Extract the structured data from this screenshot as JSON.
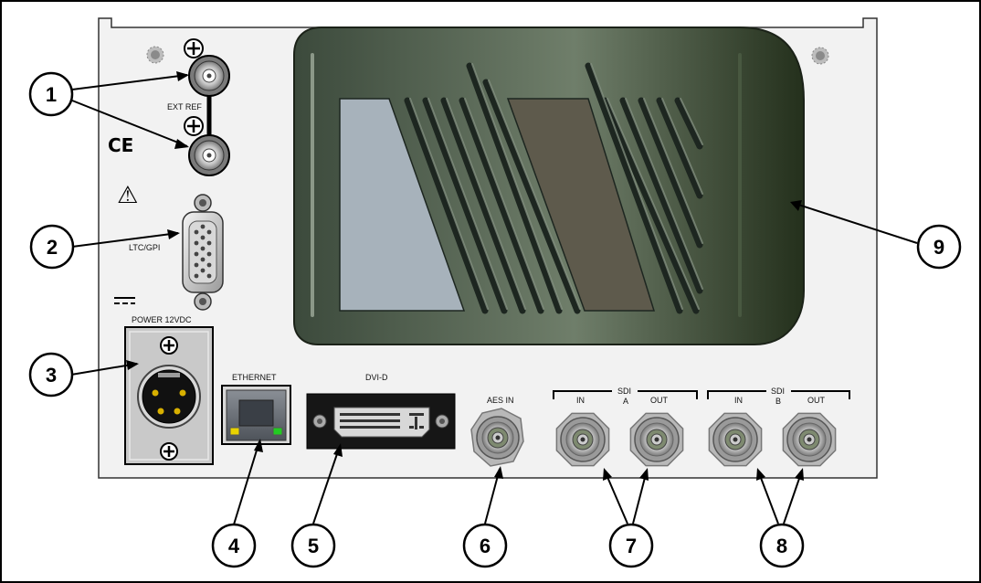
{
  "labels": {
    "ext_ref": "EXT REF",
    "ltc_gpi": "LTC/GPI",
    "power": "POWER 12VDC",
    "ethernet": "ETHERNET",
    "dvi_d": "DVI-D",
    "aes_in": "AES IN",
    "sdi_a": "SDI",
    "sdi_a_sub": "A",
    "sdi_b": "SDI",
    "sdi_b_sub": "B",
    "in_a": "IN",
    "out_a": "OUT",
    "in_b": "IN",
    "out_b": "OUT",
    "ce_mark": "CE",
    "warning_symbol": "⚠",
    "dc_symbol": "⎓"
  },
  "callouts": [
    "1",
    "2",
    "3",
    "4",
    "5",
    "6",
    "7",
    "8",
    "9"
  ],
  "colors": {
    "panel": "#f2f2f2",
    "handle_dark": "#2e3a2e",
    "handle_light": "#6f7e6a",
    "blue_window": "#a7b2bb",
    "brown_window": "#5e5a4c",
    "led_yellow": "#e8d200",
    "led_green": "#22cc22",
    "gold_pin": "#d8b000"
  },
  "icons": [
    "ground-screw-icon",
    "bnc-connector-icon",
    "warning-triangle-icon",
    "ce-mark-icon",
    "dc-power-symbol-icon",
    "xlr-connector-icon",
    "rj45-port-icon",
    "dvi-port-icon",
    "db15-port-icon"
  ]
}
